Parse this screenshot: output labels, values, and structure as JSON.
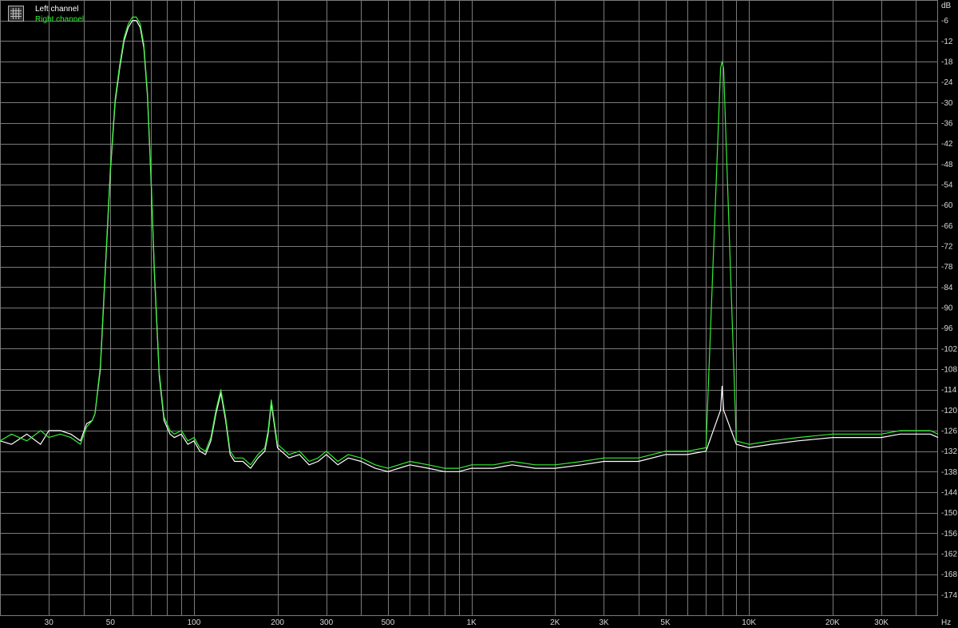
{
  "chart_data": {
    "type": "line",
    "x_scale": "log",
    "xlim": [
      20,
      48000
    ],
    "ylim": [
      -180,
      0
    ],
    "grid": true,
    "y_unit_label": "dB",
    "x_unit_label": "Hz",
    "x_tick_labels": [
      {
        "value": 30,
        "label": "30"
      },
      {
        "value": 50,
        "label": "50"
      },
      {
        "value": 100,
        "label": "100"
      },
      {
        "value": 200,
        "label": "200"
      },
      {
        "value": 300,
        "label": "300"
      },
      {
        "value": 500,
        "label": "500"
      },
      {
        "value": 1000,
        "label": "1K"
      },
      {
        "value": 2000,
        "label": "2K"
      },
      {
        "value": 3000,
        "label": "3K"
      },
      {
        "value": 5000,
        "label": "5K"
      },
      {
        "value": 10000,
        "label": "10K"
      },
      {
        "value": 20000,
        "label": "20K"
      },
      {
        "value": 30000,
        "label": "30K"
      }
    ],
    "y_tick_labels": [
      "-6",
      "-12",
      "-18",
      "-24",
      "-30",
      "-36",
      "-42",
      "-48",
      "-54",
      "-60",
      "-66",
      "-72",
      "-78",
      "-84",
      "-90",
      "-96",
      "-102",
      "-108",
      "-114",
      "-120",
      "-126",
      "-132",
      "-138",
      "-144",
      "-150",
      "-156",
      "-162",
      "-168",
      "-174"
    ],
    "legend_position": "top-left",
    "series": [
      {
        "name": "Left channel",
        "color": "#ffffff",
        "x": [
          20,
          22,
          25,
          28,
          30,
          33,
          36,
          39,
          41,
          43,
          44,
          46,
          48,
          50,
          52,
          54,
          56,
          58,
          60,
          62,
          64,
          66,
          68,
          70,
          72,
          75,
          78,
          82,
          85,
          90,
          95,
          100,
          105,
          110,
          115,
          120,
          125,
          130,
          135,
          140,
          150,
          160,
          170,
          180,
          185,
          190,
          200,
          220,
          240,
          260,
          280,
          300,
          330,
          360,
          400,
          450,
          500,
          600,
          700,
          800,
          900,
          1000,
          1200,
          1400,
          1700,
          2000,
          2500,
          3000,
          3500,
          4000,
          5000,
          6000,
          7000,
          7900,
          8000,
          8100,
          9000,
          10000,
          12000,
          15000,
          20000,
          25000,
          30000,
          35000,
          40000,
          45000,
          48000
        ],
        "y": [
          -129,
          -130,
          -127,
          -130,
          -126,
          -126,
          -127,
          -129,
          -124,
          -123,
          -121,
          -108,
          -78,
          -50,
          -30,
          -20,
          -12,
          -8,
          -6,
          -6,
          -8,
          -14,
          -28,
          -52,
          -80,
          -110,
          -123,
          -127,
          -128,
          -127,
          -130,
          -129,
          -132,
          -133,
          -129,
          -121,
          -115,
          -123,
          -133,
          -135,
          -135,
          -137,
          -134,
          -132,
          -127,
          -118,
          -131,
          -134,
          -133,
          -136,
          -135,
          -133,
          -136,
          -134,
          -135,
          -137,
          -138,
          -136,
          -137,
          -138,
          -138,
          -137,
          -137,
          -136,
          -137,
          -137,
          -136,
          -135,
          -135,
          -135,
          -133,
          -133,
          -132,
          -120,
          -113,
          -120,
          -130,
          -131,
          -130,
          -129,
          -128,
          -128,
          -128,
          -127,
          -127,
          -127,
          -128
        ]
      },
      {
        "name": "Right channel",
        "color": "#33ee33",
        "x": [
          20,
          22,
          25,
          28,
          30,
          33,
          36,
          39,
          41,
          43,
          44,
          46,
          48,
          50,
          52,
          54,
          56,
          58,
          60,
          62,
          64,
          66,
          68,
          70,
          72,
          75,
          78,
          82,
          85,
          90,
          95,
          100,
          105,
          110,
          115,
          120,
          125,
          130,
          135,
          140,
          150,
          160,
          170,
          180,
          185,
          190,
          200,
          220,
          240,
          260,
          280,
          300,
          330,
          360,
          400,
          450,
          500,
          600,
          700,
          800,
          900,
          1000,
          1200,
          1400,
          1700,
          2000,
          2500,
          3000,
          3500,
          4000,
          5000,
          6000,
          7000,
          7900,
          8000,
          8100,
          9000,
          10000,
          12000,
          15000,
          20000,
          25000,
          30000,
          35000,
          40000,
          45000,
          48000
        ],
        "y": [
          -129,
          -127,
          -129,
          -126,
          -128,
          -127,
          -128,
          -130,
          -125,
          -123,
          -121,
          -107,
          -77,
          -49,
          -29,
          -19,
          -11,
          -7,
          -5,
          -5,
          -7,
          -13,
          -27,
          -51,
          -79,
          -109,
          -122,
          -126,
          -127,
          -126,
          -129,
          -128,
          -131,
          -132,
          -128,
          -120,
          -114,
          -122,
          -132,
          -134,
          -134,
          -136,
          -133,
          -131,
          -126,
          -117,
          -130,
          -133,
          -132,
          -135,
          -134,
          -132,
          -135,
          -133,
          -134,
          -136,
          -137,
          -135,
          -136,
          -137,
          -137,
          -136,
          -136,
          -135,
          -136,
          -136,
          -135,
          -134,
          -134,
          -134,
          -132,
          -132,
          -131,
          -20,
          -18,
          -20,
          -129,
          -130,
          -129,
          -128,
          -127,
          -127,
          -127,
          -126,
          -126,
          -126,
          -127
        ]
      }
    ]
  },
  "legend": {
    "left_label": "Left channel",
    "right_label": "Right channel"
  },
  "style": {
    "background": "#000000",
    "grid_color": "#7a7a7a",
    "axis_text_color": "#d8d8d8"
  }
}
